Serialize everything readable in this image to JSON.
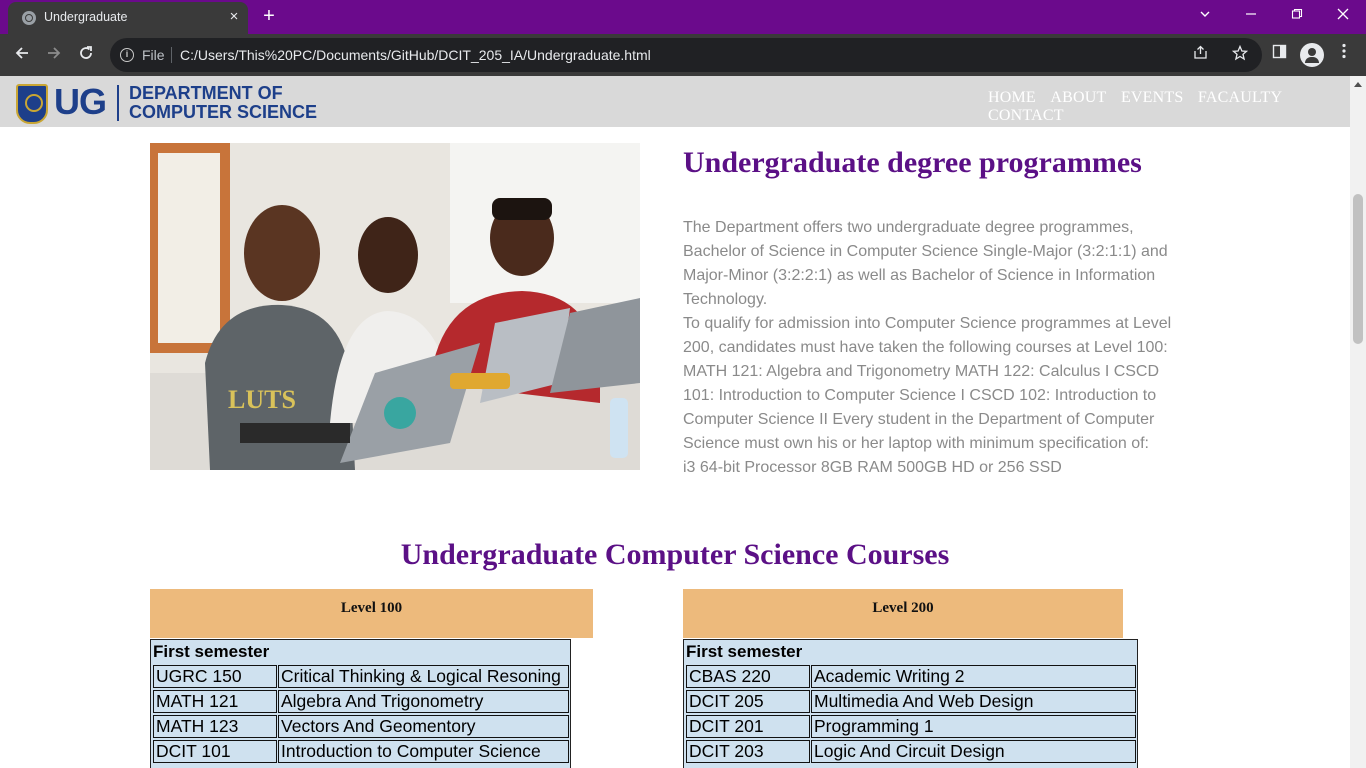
{
  "browser": {
    "tab_title": "Undergraduate",
    "new_tab_symbol": "+",
    "close_symbol": "×",
    "file_label": "File",
    "url": "C:/Users/This%20PC/Documents/GitHub/DCIT_205_IA/Undergraduate.html"
  },
  "header": {
    "logo_mark": "UG",
    "logo_line1": "DEPARTMENT OF",
    "logo_line2": "COMPUTER SCIENCE",
    "nav": [
      "HOME",
      "ABOUT",
      "EVENTS",
      "FACAULTY",
      "CONTACT"
    ]
  },
  "intro": {
    "title": "Undergraduate degree programmes",
    "para1": "The Department offers two undergraduate degree programmes, Bachelor of Science in Computer Science Single-Major (3:2:1:1) and Major-Minor (3:2:2:1) as well as Bachelor of Science in Information Technology.",
    "para2": "To qualify for admission into Computer Science programmes at Level 200, candidates must have taken the following courses at Level 100: MATH 121: Algebra and Trigonometry MATH 122: Calculus I CSCD 101: Introduction to Computer Science I CSCD 102: Introduction to Computer Science II Every student in the Department of Computer Science must own his or her laptop with minimum specification of:",
    "para3": "i3 64-bit Processor 8GB RAM 500GB HD or 256 SSD"
  },
  "courses": {
    "title": "Undergraduate Computer Science Courses",
    "level100": {
      "label": "Level 100",
      "semester": "First semester",
      "rows": [
        [
          "UGRC 150",
          "Critical Thinking & Logical Resoning"
        ],
        [
          "MATH 121",
          "Algebra And Trigonometry"
        ],
        [
          "MATH 123",
          "Vectors And Geomentory"
        ],
        [
          "DCIT 101",
          "Introduction to Computer Science"
        ]
      ]
    },
    "level200": {
      "label": "Level 200",
      "semester": "First semester",
      "rows": [
        [
          "CBAS 220",
          "Academic Writing 2"
        ],
        [
          "DCIT 205",
          "Multimedia And Web Design"
        ],
        [
          "DCIT 201",
          "Programming 1"
        ],
        [
          "DCIT 203",
          "Logic And Circuit Design"
        ]
      ]
    }
  },
  "colors": {
    "chrome_purple": "#6b0a8c",
    "heading_purple": "#5b1086",
    "level_header": "#edba7c",
    "table_bg": "#cfe1ef",
    "ug_blue": "#1d3f8a"
  }
}
